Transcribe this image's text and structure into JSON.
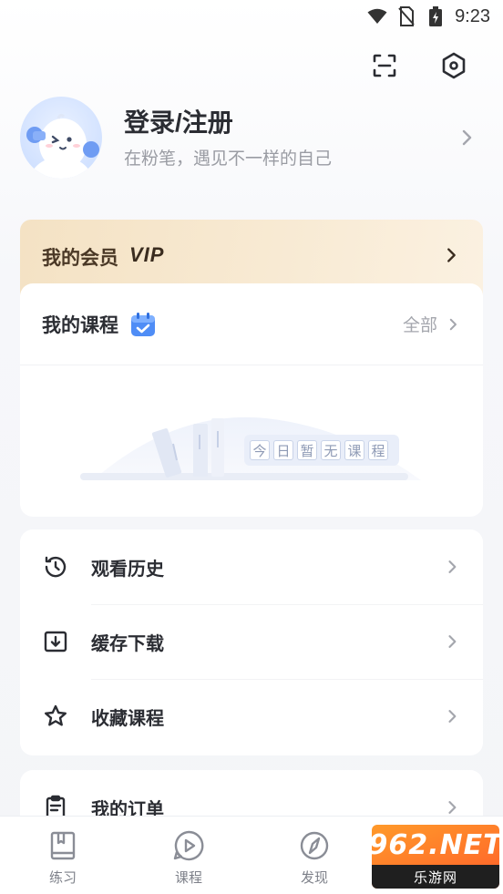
{
  "status_bar": {
    "time": "9:23",
    "icons": [
      "wifi-icon",
      "no-sim-icon",
      "battery-charging-icon"
    ]
  },
  "top_actions": {
    "icons": [
      "scan-icon",
      "settings-hexagon-icon"
    ]
  },
  "profile": {
    "title": "登录/注册",
    "subtitle": "在粉笔，遇见不一样的自己"
  },
  "vip": {
    "label": "我的会员",
    "badge": "VIP"
  },
  "courses": {
    "title": "我的课程",
    "all_label": "全部",
    "empty_text": [
      "今",
      "日",
      "暂",
      "无",
      "课",
      "程"
    ]
  },
  "menu": [
    {
      "label": "观看历史",
      "icon": "history-clock-icon"
    },
    {
      "label": "缓存下载",
      "icon": "download-box-icon"
    },
    {
      "label": "收藏课程",
      "icon": "star-icon"
    }
  ],
  "orders": {
    "label": "我的订单",
    "icon": "clipboard-icon"
  },
  "bottom_nav": [
    {
      "label": "练习",
      "icon": "book-icon"
    },
    {
      "label": "课程",
      "icon": "play-bubble-icon"
    },
    {
      "label": "发现",
      "icon": "compass-icon"
    },
    {
      "label": "",
      "icon": "mascot-icon"
    }
  ],
  "watermark": {
    "top": "962.NET",
    "bottom": "乐游网"
  },
  "colors": {
    "accent": "#3d7bff",
    "vip_bg": "#f4e2c4",
    "text_primary": "#2b2d33",
    "text_secondary": "#9a9ca3"
  }
}
